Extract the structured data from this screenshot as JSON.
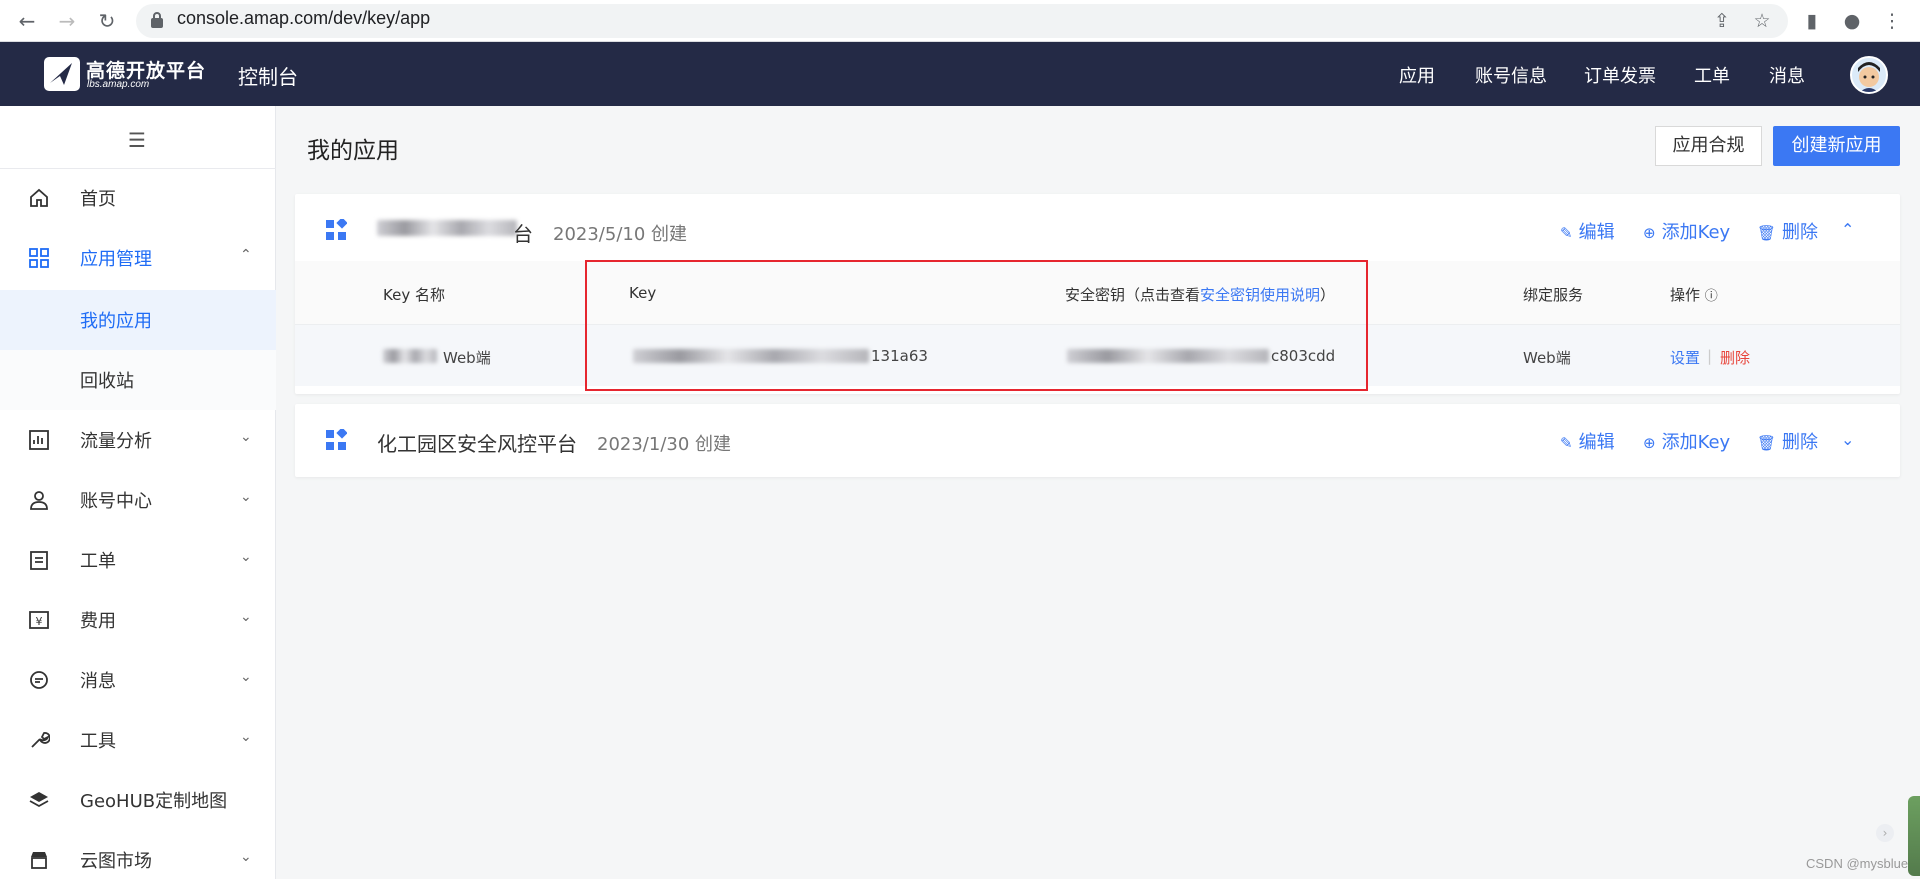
{
  "browser": {
    "url": "console.amap.com/dev/key/app"
  },
  "topnav": {
    "logo_cn": "高德开放平台",
    "logo_en": "lbs.amap.com",
    "console_title": "控制台",
    "items": [
      "应用",
      "账号信息",
      "订单发票",
      "工单",
      "消息"
    ]
  },
  "sidebar": {
    "items": [
      {
        "label": "首页",
        "icon": "home-icon"
      },
      {
        "label": "应用管理",
        "icon": "grid-icon"
      },
      {
        "label": "我的应用"
      },
      {
        "label": "回收站"
      },
      {
        "label": "流量分析",
        "icon": "chart-icon"
      },
      {
        "label": "账号中心",
        "icon": "user-icon"
      },
      {
        "label": "工单",
        "icon": "ticket-icon"
      },
      {
        "label": "费用",
        "icon": "yuan-icon"
      },
      {
        "label": "消息",
        "icon": "message-icon"
      },
      {
        "label": "工具",
        "icon": "wrench-icon"
      },
      {
        "label": "GeoHUB定制地图",
        "icon": "layers-icon"
      },
      {
        "label": "云图市场",
        "icon": "store-icon"
      }
    ]
  },
  "main": {
    "title": "我的应用",
    "btn_compliance": "应用合规",
    "btn_create": "创建新应用",
    "apps": [
      {
        "name_visible": "台",
        "date": "2023/5/10 创建",
        "actions": [
          "编辑",
          "添加Key",
          "删除"
        ],
        "table": {
          "headers": [
            "Key 名称",
            "Key",
            "安全密钥（点击查看",
            "安全密钥使用说明",
            "）",
            "绑定服务",
            "操作"
          ],
          "rows": [
            {
              "name_suffix": "Web端",
              "key_suffix": "131a63",
              "secret_suffix": "c803cdd",
              "service": "Web端",
              "op_set": "设置",
              "op_del": "删除"
            }
          ]
        }
      },
      {
        "name": "化工园区安全风控平台",
        "date": "2023/1/30 创建",
        "actions": [
          "编辑",
          "添加Key",
          "删除"
        ]
      }
    ]
  },
  "watermark": "CSDN @mysblue",
  "colors": {
    "primary": "#3b78f3",
    "nav_bg": "#242a46",
    "danger": "#e8443a",
    "highlight": "#e6262f"
  }
}
